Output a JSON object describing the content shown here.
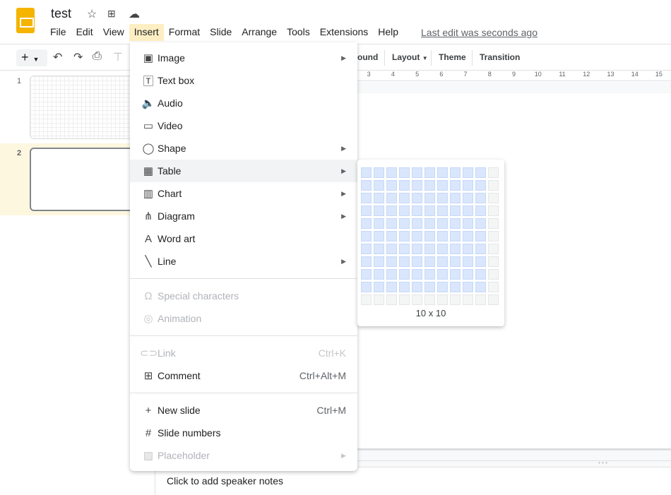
{
  "app": {
    "title": "test",
    "last_edit": "Last edit was seconds ago",
    "accent": "#f4b400"
  },
  "menubar": [
    "File",
    "Edit",
    "View",
    "Insert",
    "Format",
    "Slide",
    "Arrange",
    "Tools",
    "Extensions",
    "Help"
  ],
  "toolbar": {
    "background_partial": "ound",
    "layout": "Layout",
    "theme": "Theme",
    "transition": "Transition"
  },
  "ruler": [
    "3",
    "4",
    "5",
    "6",
    "7",
    "8",
    "9",
    "10",
    "11",
    "12",
    "13",
    "14",
    "15"
  ],
  "slides": [
    {
      "number": "1"
    },
    {
      "number": "2",
      "selected": true
    }
  ],
  "notes_placeholder": "Click to add speaker notes",
  "insert_menu": {
    "group1": [
      {
        "label": "Image",
        "icon": "image-icon",
        "submenu": true
      },
      {
        "label": "Text box",
        "icon": "text-box-icon"
      },
      {
        "label": "Audio",
        "icon": "audio-icon"
      },
      {
        "label": "Video",
        "icon": "video-icon"
      },
      {
        "label": "Shape",
        "icon": "shape-icon",
        "submenu": true
      },
      {
        "label": "Table",
        "icon": "table-icon",
        "submenu": true,
        "highlighted": true
      },
      {
        "label": "Chart",
        "icon": "chart-icon",
        "submenu": true
      },
      {
        "label": "Diagram",
        "icon": "diagram-icon",
        "submenu": true
      },
      {
        "label": "Word art",
        "icon": "word-art-icon"
      },
      {
        "label": "Line",
        "icon": "line-icon",
        "submenu": true
      }
    ],
    "group2": [
      {
        "label": "Special characters",
        "icon": "omega-icon",
        "disabled": true
      },
      {
        "label": "Animation",
        "icon": "animation-icon",
        "disabled": true
      }
    ],
    "group3": [
      {
        "label": "Link",
        "shortcut": "Ctrl+K",
        "icon": "link-icon",
        "disabled": true
      },
      {
        "label": "Comment",
        "shortcut": "Ctrl+Alt+M",
        "icon": "comment-icon"
      }
    ],
    "group4": [
      {
        "label": "New slide",
        "shortcut": "Ctrl+M",
        "icon": "plus-icon"
      },
      {
        "label": "Slide numbers",
        "icon": "hash-icon"
      },
      {
        "label": "Placeholder",
        "icon": "placeholder-icon",
        "submenu": true,
        "disabled": true
      }
    ]
  },
  "table_picker": {
    "size_label": "10 x 10",
    "rows_selected": 10,
    "cols_selected": 10,
    "grid_rows": 11,
    "grid_cols": 11
  }
}
